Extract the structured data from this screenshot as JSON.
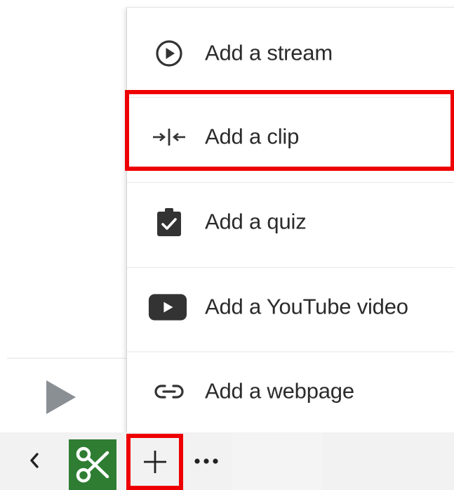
{
  "menu": {
    "items": [
      {
        "icon": "play-circle-icon",
        "label": "Add a stream"
      },
      {
        "icon": "clip-arrows-icon",
        "label": "Add a clip"
      },
      {
        "icon": "clipboard-check-icon",
        "label": "Add a quiz"
      },
      {
        "icon": "youtube-icon",
        "label": "Add a YouTube video"
      },
      {
        "icon": "link-icon",
        "label": "Add a webpage"
      }
    ]
  },
  "toolbar": {
    "icons": [
      "back-chevron-icon",
      "scissors-icon",
      "plus-icon",
      "more-horizontal-icon"
    ]
  },
  "player": {
    "icon": "play-icon"
  },
  "colors": {
    "highlight": "#ee0000",
    "scissors_bg": "#2e7d32",
    "menu_text": "#2b2b2b",
    "icon_dark": "#333333",
    "play_gray": "#8a8f94",
    "toolbar_bg": "#f2f2f2"
  }
}
